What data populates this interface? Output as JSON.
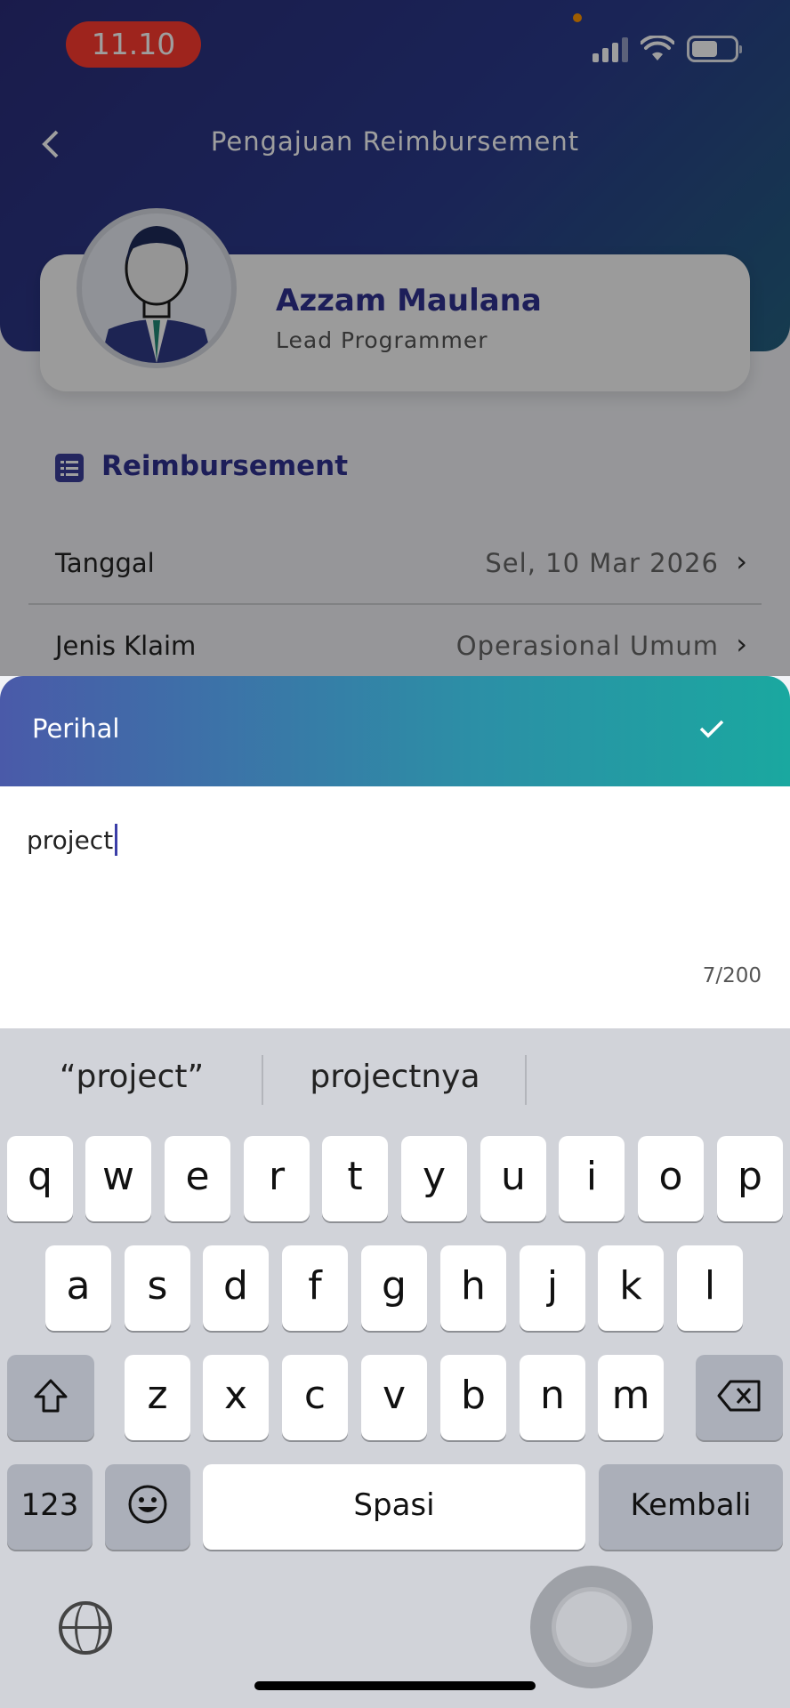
{
  "status_bar": {
    "time": "11.10"
  },
  "header": {
    "title": "Pengajuan Reimbursement"
  },
  "profile": {
    "name": "Azzam Maulana",
    "role": "Lead Programmer"
  },
  "section": {
    "title": "Reimbursement"
  },
  "rows": [
    {
      "label": "Tanggal",
      "value": "Sel, 10 Mar 2026"
    },
    {
      "label": "Jenis Klaim",
      "value": "Operasional Umum"
    }
  ],
  "sheet": {
    "title": "Perihal",
    "input_value": "project",
    "counter": "7/200"
  },
  "keyboard": {
    "suggestions": [
      "“project”",
      "projectnya"
    ],
    "row1": [
      "q",
      "w",
      "e",
      "r",
      "t",
      "y",
      "u",
      "i",
      "o",
      "p"
    ],
    "row2": [
      "a",
      "s",
      "d",
      "f",
      "g",
      "h",
      "j",
      "k",
      "l"
    ],
    "row3": [
      "z",
      "x",
      "c",
      "v",
      "b",
      "n",
      "m"
    ],
    "numbers_key": "123",
    "space_key": "Spasi",
    "return_key": "Kembali"
  }
}
